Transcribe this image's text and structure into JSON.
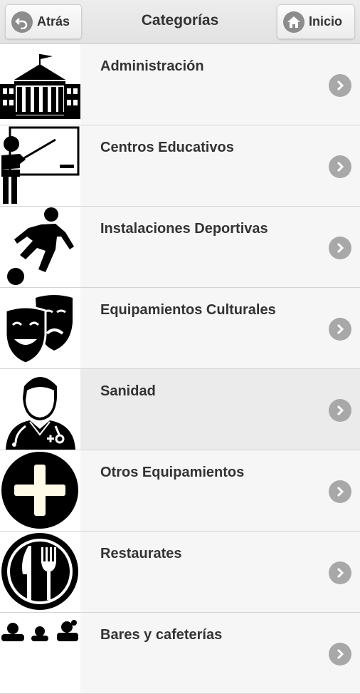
{
  "header": {
    "title": "Categorías",
    "back_label": "Atrás",
    "home_label": "Inicio"
  },
  "categories": [
    {
      "label": "Administración",
      "icon": "government-building-icon"
    },
    {
      "label": "Centros Educativos",
      "icon": "teacher-blackboard-icon"
    },
    {
      "label": "Instalaciones Deportivas",
      "icon": "soccer-player-icon"
    },
    {
      "label": "Equipamientos Culturales",
      "icon": "theater-masks-icon"
    },
    {
      "label": "Sanidad",
      "icon": "doctor-icon"
    },
    {
      "label": "Otros Equipamientos",
      "icon": "plus-circle-icon"
    },
    {
      "label": "Restaurates",
      "icon": "knife-fork-icon"
    },
    {
      "label": "Bares y cafeterías",
      "icon": "people-group-icon"
    }
  ]
}
